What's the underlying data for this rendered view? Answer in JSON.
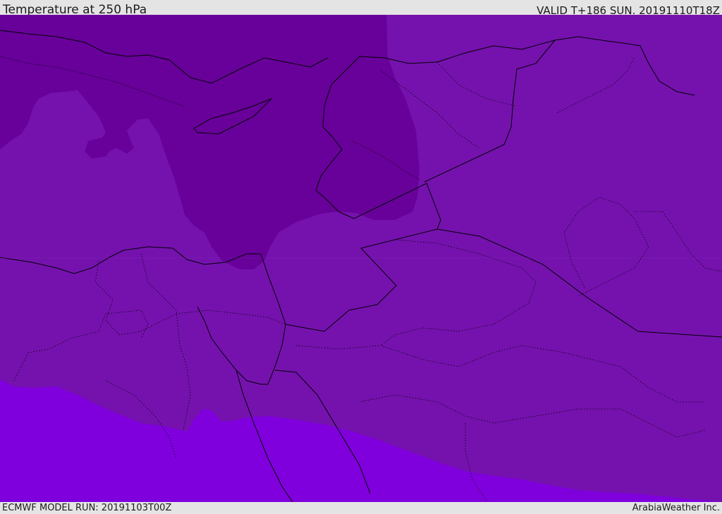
{
  "header": {
    "title": "Temperature at 250 hPa",
    "valid_time": "VALID T+186 SUN. 20191110T18Z"
  },
  "footer": {
    "model_run": "ECMWF MODEL RUN: 20191103T00Z",
    "credit": "ArabiaWeather Inc."
  },
  "colors": {
    "cold_band": "#68009a",
    "mid_band": "#7512ae",
    "warm_band": "#7f00dc",
    "border_line": "#000000",
    "bar_background": "#e4e4e4"
  }
}
